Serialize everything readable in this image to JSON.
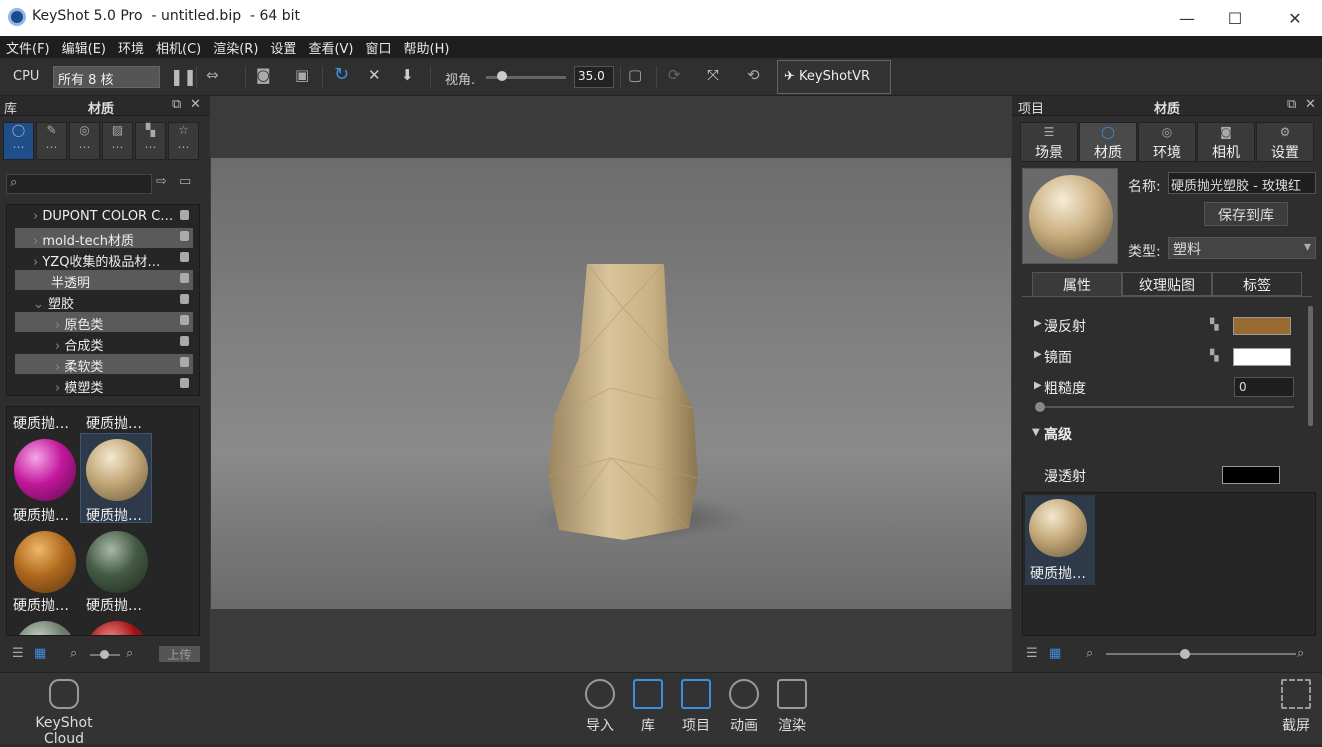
{
  "window": {
    "title": "KeyShot 5.0 Pro  - untitled.bip  - 64 bit",
    "minimize": "—",
    "maximize": "☐",
    "close": "✕"
  },
  "menu": [
    "文件(F)",
    "编辑(E)",
    "环境",
    "相机(C)",
    "渲染(R)",
    "设置",
    "查看(V)",
    "窗口",
    "帮助(H)"
  ],
  "toolbar": {
    "cpu": "CPU",
    "cores": "所有 8 核",
    "fov_label": "视角.",
    "fov_value": "35.0",
    "vr_label": "KeyShotVR",
    "fov_level": 0.14
  },
  "library": {
    "section_label": "库",
    "title": "材质",
    "tree": [
      {
        "label": "DUPONT COLOR C…",
        "highlight": false
      },
      {
        "label": "mold-tech材质",
        "highlight": true
      },
      {
        "label": "YZQ收集的极品材…",
        "highlight": false
      },
      {
        "label": "半透明",
        "highlight": true
      },
      {
        "label": "塑胶",
        "highlight": false
      },
      {
        "label": "原色类",
        "highlight": true
      },
      {
        "label": "合成类",
        "highlight": false
      },
      {
        "label": "柔软类",
        "highlight": true
      },
      {
        "label": "模塑类",
        "highlight": false
      }
    ],
    "thumb_labels": [
      "硬质抛…",
      "硬质抛…",
      "硬质抛…",
      "硬质抛…",
      "硬质抛…",
      "硬质抛…"
    ],
    "upload": "上传"
  },
  "project": {
    "section_label": "项目",
    "title": "材质",
    "tabs": [
      "场景",
      "材质",
      "环境",
      "相机",
      "设置"
    ],
    "name_label": "名称:",
    "name_value": "硬质抛光塑胶 - 玫瑰红",
    "save_button": "保存到库",
    "type_label": "类型:",
    "type_value": "塑料",
    "subtabs": [
      "属性",
      "纹理贴图",
      "标签"
    ],
    "props": {
      "diffuse": "漫反射",
      "specular": "镜面",
      "roughness": "粗糙度",
      "roughness_value": "0",
      "advanced": "高级",
      "diffuse_transmission": "漫透射"
    },
    "colors": {
      "diffuse": "#9a6a33",
      "specular": "#ffffff",
      "transmission": "#000000"
    },
    "thumb_label": "硬质抛…"
  },
  "bottom": {
    "cloud": "KeyShot Cloud",
    "import": "导入",
    "library": "库",
    "project": "项目",
    "animation": "动画",
    "render": "渲染",
    "screenshot": "截屏"
  }
}
